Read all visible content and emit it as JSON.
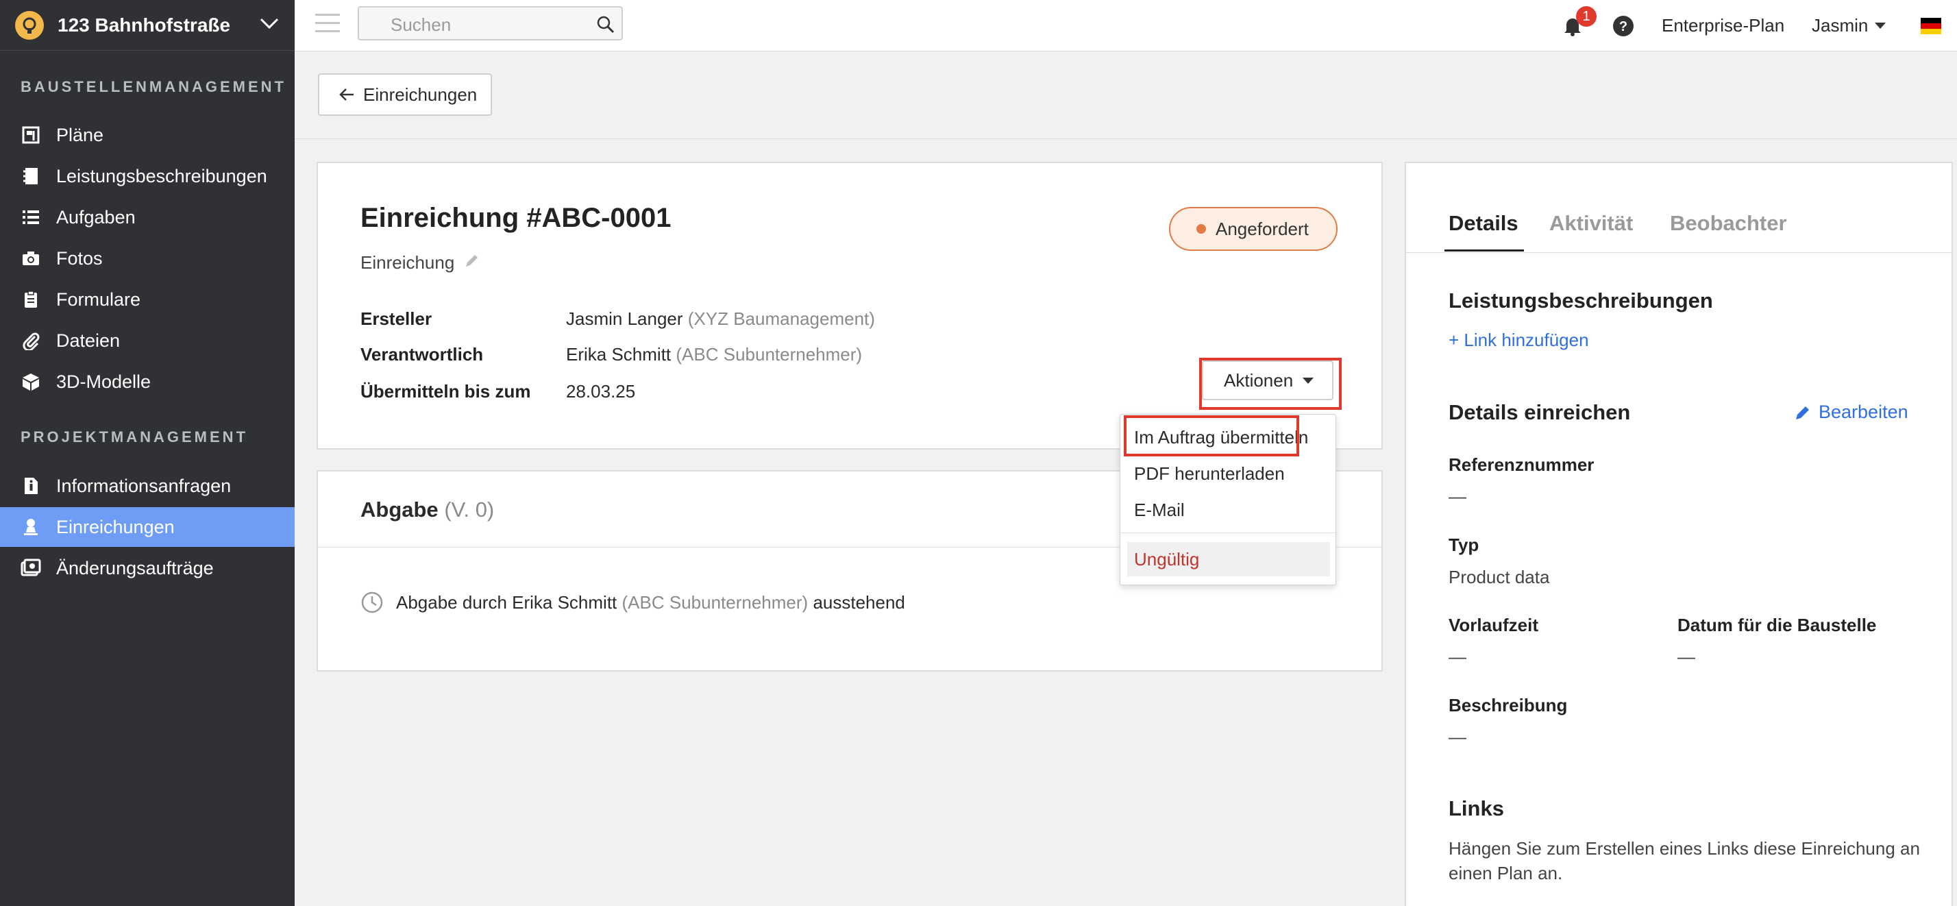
{
  "sidebar": {
    "project_name": "123 Bahnhofstraße",
    "section_site": "BAUSTELLENMANAGEMENT",
    "section_project": "PROJEKTMANAGEMENT",
    "items": [
      {
        "label": "Pläne",
        "icon": "plans-icon"
      },
      {
        "label": "Leistungsbeschreibungen",
        "icon": "notebook-icon"
      },
      {
        "label": "Aufgaben",
        "icon": "list-icon"
      },
      {
        "label": "Fotos",
        "icon": "camera-icon"
      },
      {
        "label": "Formulare",
        "icon": "clipboard-icon"
      },
      {
        "label": "Dateien",
        "icon": "paperclip-icon"
      },
      {
        "label": "3D-Modelle",
        "icon": "cube-icon"
      },
      {
        "label": "Informationsanfragen",
        "icon": "info-document-icon"
      },
      {
        "label": "Einreichungen",
        "icon": "person-stamp-icon",
        "active": true
      },
      {
        "label": "Änderungsaufträge",
        "icon": "change-order-icon"
      }
    ]
  },
  "topbar": {
    "search_placeholder": "Suchen",
    "notification_count": "1",
    "plan": "Enterprise-Plan",
    "user": "Jasmin"
  },
  "back_button": "Einreichungen",
  "submission": {
    "title": "Einreichung #ABC-0001",
    "subtitle": "Einreichung",
    "status": "Angefordert",
    "status_color": "#e37b46",
    "creator_label": "Ersteller",
    "creator_name": "Jasmin Langer",
    "creator_company": "(XYZ Baumanagement)",
    "responsible_label": "Verantwortlich",
    "responsible_name": "Erika Schmitt",
    "responsible_company": "(ABC Subunternehmer)",
    "due_label": "Übermitteln bis zum",
    "due_date": "28.03.25",
    "actions_label": "Aktionen"
  },
  "actions_menu": {
    "items": [
      "Im Auftrag übermitteln",
      "PDF herunterladen",
      "E-Mail"
    ],
    "danger": "Ungültig"
  },
  "delivery": {
    "title": "Abgabe",
    "version": "(V. 0)",
    "status_prefix": "Abgabe durch Erika Schmitt",
    "status_company": "(ABC Subunternehmer)",
    "status_suffix": "ausstehend"
  },
  "details_panel": {
    "tabs": [
      "Details",
      "Aktivität",
      "Beobachter"
    ],
    "specs_title": "Leistungsbeschreibungen",
    "add_link": "+ Link hinzufügen",
    "submit_details_title": "Details einreichen",
    "edit_label": "Bearbeiten",
    "reference_label": "Referenznummer",
    "reference_value": "—",
    "type_label": "Typ",
    "type_value": "Product data",
    "lead_time_label": "Vorlaufzeit",
    "lead_time_value": "—",
    "site_date_label": "Datum für die Baustelle",
    "site_date_value": "—",
    "description_label": "Beschreibung",
    "description_value": "—",
    "links_title": "Links",
    "links_text_line1": "Hängen Sie zum Erstellen eines Links diese Einreichung an",
    "links_text_line2": "einen Plan an."
  },
  "colors": {
    "sidebar_bg": "#303134",
    "active_item": "#6f9cf5",
    "link": "#2f6fe0",
    "highlight": "#e03a2f",
    "danger": "#c3332a"
  }
}
